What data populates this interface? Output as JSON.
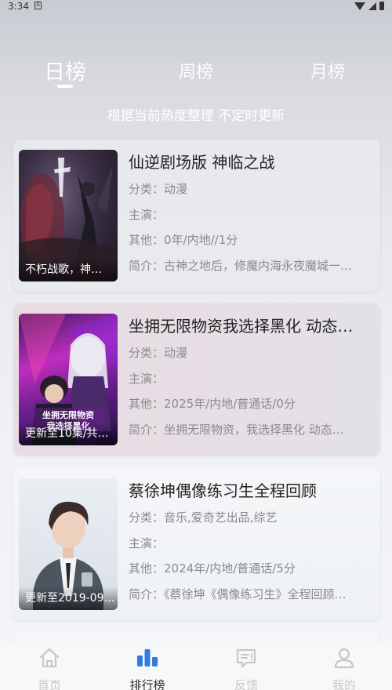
{
  "status": {
    "time": "3:34",
    "notification": "A"
  },
  "tabs": [
    {
      "label": "日榜",
      "active": true
    },
    {
      "label": "周榜",
      "active": false
    },
    {
      "label": "月榜",
      "active": false
    }
  ],
  "subtitle": "根据当前热度整理 不定时更新",
  "labels": {
    "category": "分类：",
    "cast": "主演：",
    "other": "其他：",
    "intro": "简介："
  },
  "items": [
    {
      "title": "仙逆剧场版 神临之战",
      "poster_label": "不朽战歌，神…",
      "category": "动漫",
      "cast": "",
      "other": "0年/内地//1分",
      "intro": "古神之地后，修魔内海永夜魔城一…"
    },
    {
      "title": "坐拥无限物资我选择黑化 动态…",
      "poster_label": "更新至10集/共…",
      "category": "动漫",
      "cast": "",
      "other": "2025年/内地/普通话/0分",
      "intro": "坐拥无限物资，我选择黑化 动态…"
    },
    {
      "title": "蔡徐坤偶像练习生全程回顾",
      "poster_label": "更新至2019-09…",
      "category": "音乐,爱奇艺出品,综艺",
      "cast": "",
      "other": "2024年/内地/普通话/5分",
      "intro": "《蔡徐坤《偶像练习生》全程回顾…"
    }
  ],
  "nav": [
    {
      "label": "首页",
      "icon": "home-icon",
      "active": false
    },
    {
      "label": "排行榜",
      "icon": "bar-chart-icon",
      "active": true
    },
    {
      "label": "反馈",
      "icon": "feedback-icon",
      "active": false
    },
    {
      "label": "我的",
      "icon": "user-icon",
      "active": false
    }
  ],
  "colors": {
    "active_nav": "#2f7be0",
    "inactive_nav": "#c8c8c8",
    "tab_text": "#ffffff"
  }
}
